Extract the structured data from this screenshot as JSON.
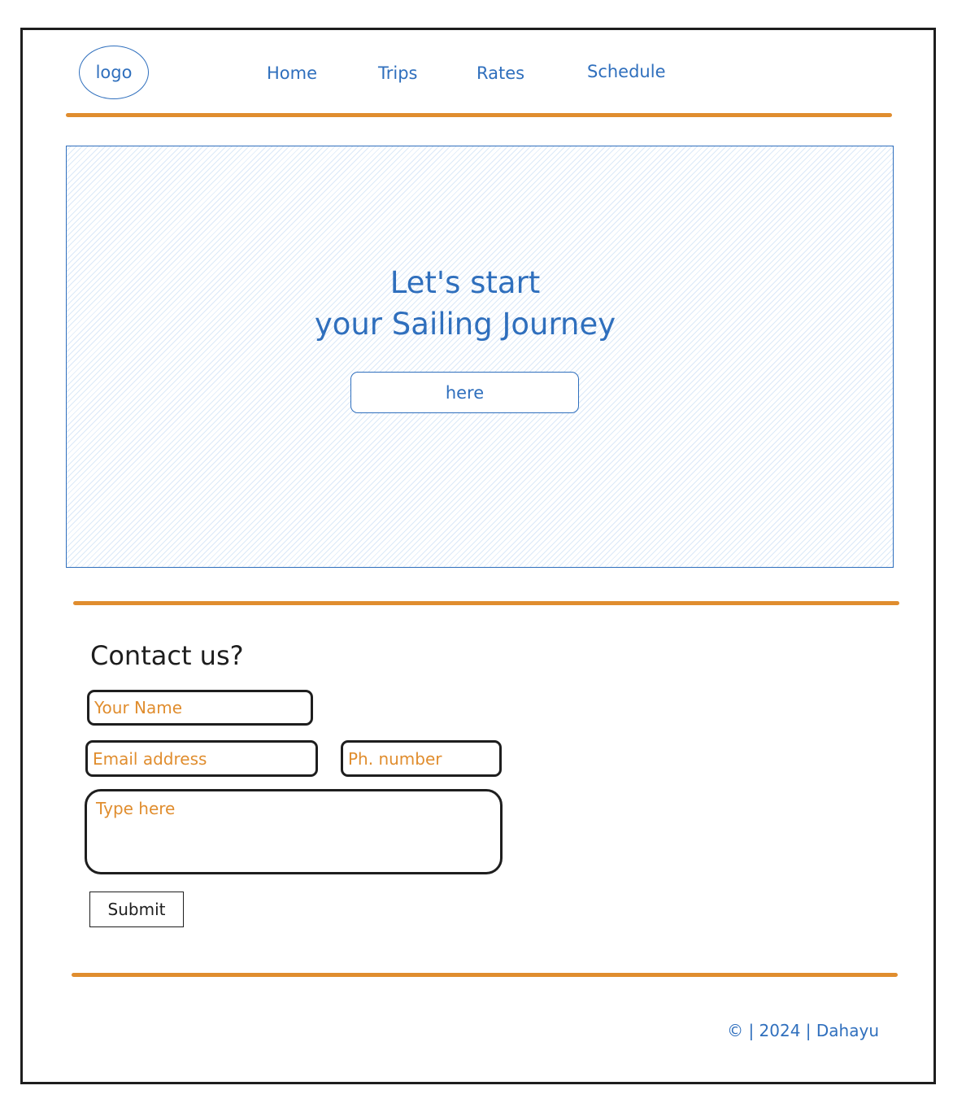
{
  "header": {
    "logo_label": "logo",
    "nav": {
      "home": "Home",
      "trips": "Trips",
      "rates": "Rates",
      "schedule": "Schedule"
    }
  },
  "hero": {
    "title_line1": "Let's start",
    "title_line2": "your Sailing Journey",
    "button_label": "here"
  },
  "contact": {
    "heading": "Contact us?",
    "name_placeholder": "Your Name",
    "email_placeholder": "Email address",
    "phone_placeholder": "Ph. number",
    "message_placeholder": "Type here",
    "submit_label": "Submit"
  },
  "footer": {
    "text": "© | 2024 | Dahayu"
  },
  "colors": {
    "accent_orange": "#e08d2e",
    "link_blue": "#2f6fbd",
    "ink": "#1e1e1e"
  }
}
